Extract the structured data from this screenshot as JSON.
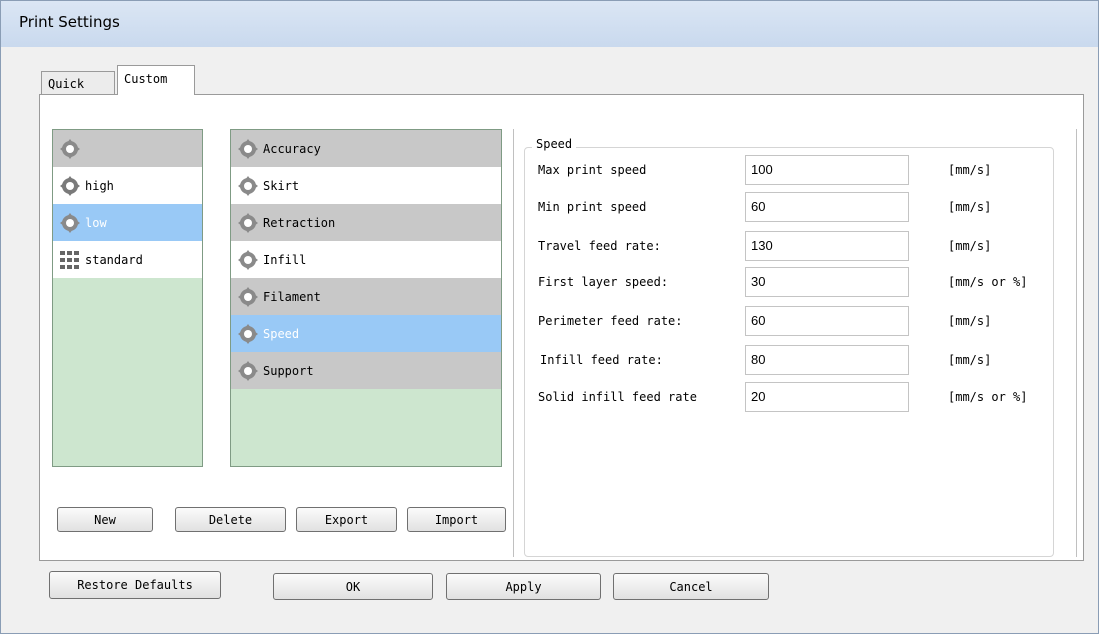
{
  "window": {
    "title": "Print Settings"
  },
  "tabs": {
    "quick": "Quick",
    "custom": "Custom"
  },
  "profiles": [
    {
      "label": "",
      "icon": "gear-cross-icon",
      "state": "header"
    },
    {
      "label": "high",
      "icon": "gear-cross-icon",
      "state": "normal"
    },
    {
      "label": "low",
      "icon": "gear-cross-icon",
      "state": "selected"
    },
    {
      "label": "standard",
      "icon": "grid-icon",
      "state": "normal"
    }
  ],
  "categories": [
    {
      "label": "Accuracy",
      "icon": "gear-cross-icon",
      "state": "gray"
    },
    {
      "label": "Skirt",
      "icon": "gear-cross-icon",
      "state": "white"
    },
    {
      "label": "Retraction",
      "icon": "gear-cross-icon",
      "state": "gray"
    },
    {
      "label": "Infill",
      "icon": "gear-cross-icon",
      "state": "white"
    },
    {
      "label": "Filament",
      "icon": "gear-cross-icon",
      "state": "gray"
    },
    {
      "label": "Speed",
      "icon": "gear-cross-icon",
      "state": "selected"
    },
    {
      "label": "Support",
      "icon": "gear-cross-icon",
      "state": "gray"
    }
  ],
  "list_buttons": {
    "new": "New",
    "delete": "Delete",
    "export": "Export",
    "import": "Import"
  },
  "speed_group": {
    "title": "Speed",
    "fields": [
      {
        "label": "Max print speed",
        "value": "100",
        "unit": "[mm/s]"
      },
      {
        "label": "Min print speed",
        "value": "60",
        "unit": "[mm/s]"
      },
      {
        "label": "Travel feed rate:",
        "value": "130",
        "unit": "[mm/s]"
      },
      {
        "label": "First layer speed:",
        "value": "30",
        "unit": "[mm/s or %]"
      },
      {
        "label": "Perimeter feed rate:",
        "value": "60",
        "unit": "[mm/s]"
      },
      {
        "label": "Infill feed rate:",
        "value": "80",
        "unit": "[mm/s]"
      },
      {
        "label": "Solid infill feed rate",
        "value": "20",
        "unit": "[mm/s or %]"
      }
    ]
  },
  "footer_buttons": {
    "restore": "Restore Defaults",
    "ok": "OK",
    "apply": "Apply",
    "cancel": "Cancel"
  },
  "colors": {
    "selected": "#99c9f6",
    "list_bg": "#cde6cf",
    "gray_row": "#c8c8c8"
  }
}
